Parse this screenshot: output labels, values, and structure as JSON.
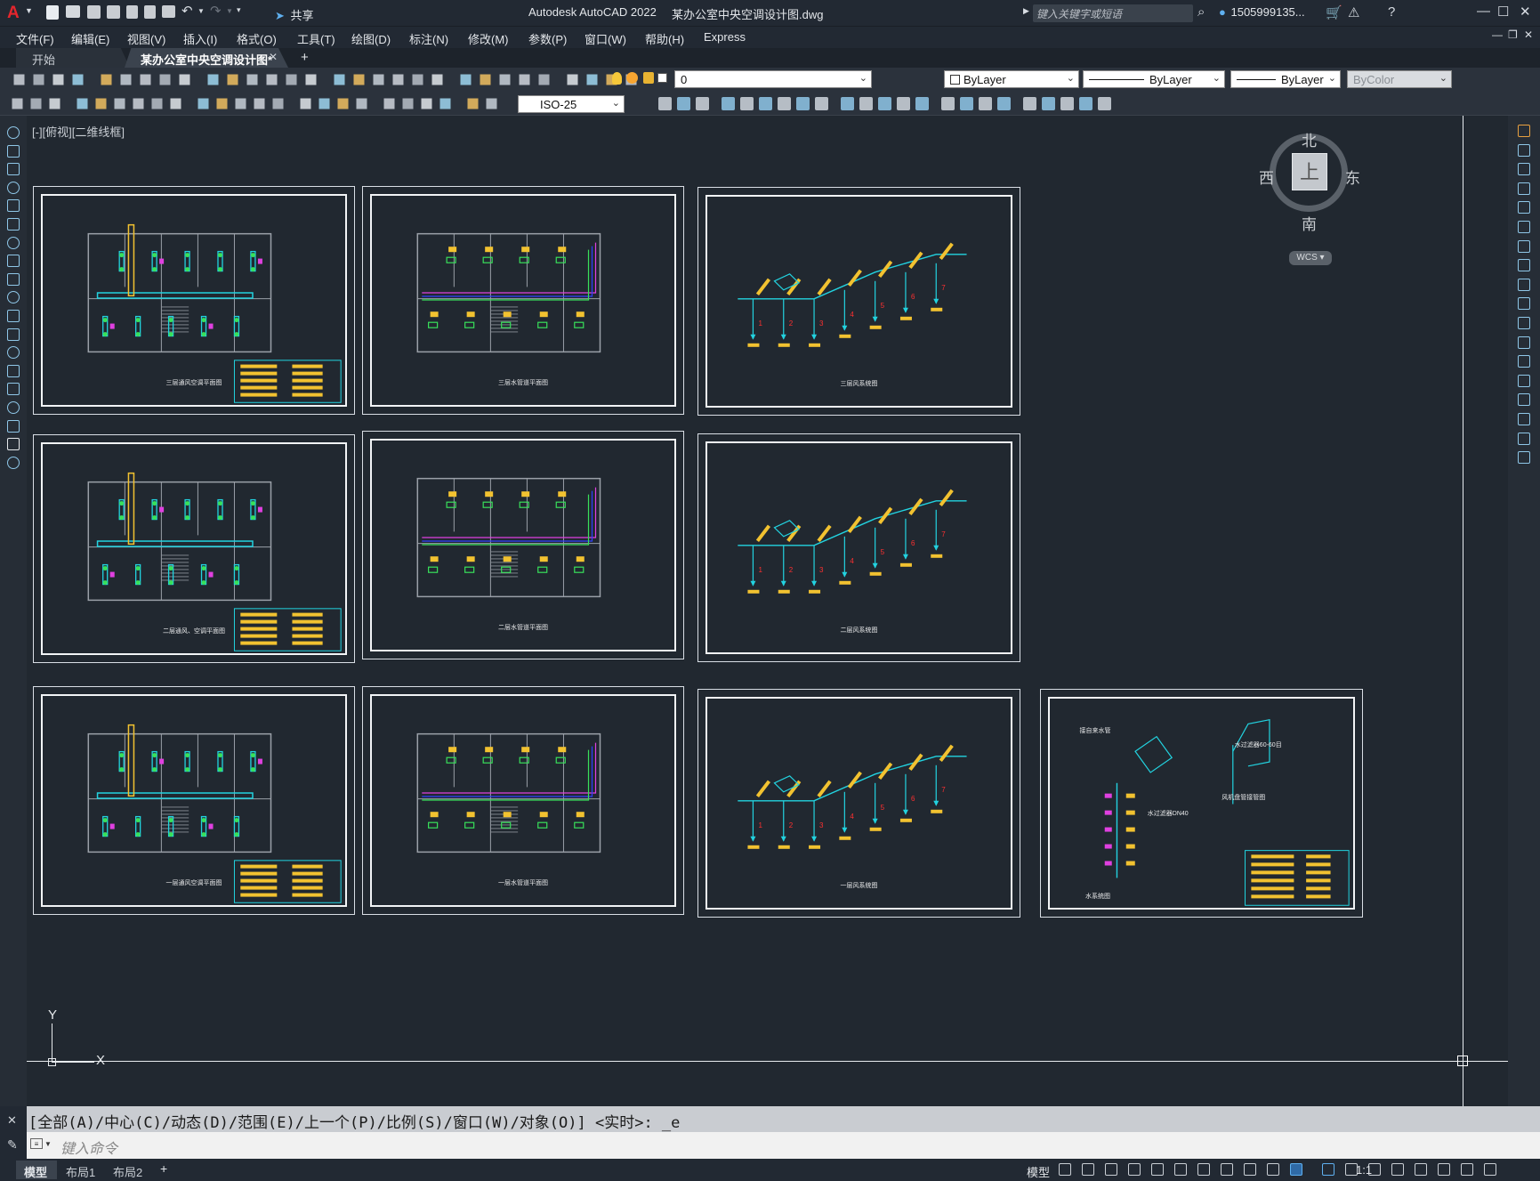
{
  "titlebar": {
    "app_title": "Autodesk AutoCAD 2022",
    "file_title": "某办公室中央空调设计图.dwg",
    "share_label": "共享",
    "search_placeholder": "键入关键字或短语",
    "user_label": "1505999135..."
  },
  "menu": [
    "文件(F)",
    "编辑(E)",
    "视图(V)",
    "插入(I)",
    "格式(O)",
    "工具(T)",
    "绘图(D)",
    "标注(N)",
    "修改(M)",
    "参数(P)",
    "窗口(W)",
    "帮助(H)",
    "Express"
  ],
  "tabs": {
    "start": "开始",
    "active": "某办公室中央空调设计图*",
    "add": "+"
  },
  "ribbon": {
    "layer_value": "0",
    "color_value": "ByLayer",
    "linetype_value": "ByLayer",
    "lineweight_value": "ByLayer",
    "plotstyle_value": "ByColor",
    "dimstyle_value": "ISO-25"
  },
  "viewport": {
    "label": "[-][俯视][二维线框]"
  },
  "viewcube": {
    "north": "北",
    "south": "南",
    "west": "西",
    "east": "东",
    "top": "上",
    "wcs": "WCS"
  },
  "ucs": {
    "y": "Y",
    "x": "X"
  },
  "sheets": [
    {
      "caption": "三层通风空调平面图"
    },
    {
      "caption": "三层水管道平面图"
    },
    {
      "caption": "三层风系统图"
    },
    {
      "caption": "二层通风、空调平面图"
    },
    {
      "caption": "二层水管道平面图"
    },
    {
      "caption": "二层风系统图"
    },
    {
      "caption": "一层通风空调平面图"
    },
    {
      "caption": "一层水管道平面图"
    },
    {
      "caption": "一层风系统图"
    },
    {
      "caption": "水系统图"
    }
  ],
  "sheet_annotations": {
    "fan_coil_label": "风机盘管接管图",
    "filter_label": "水过滤器60-60目",
    "note1": "接自来水管",
    "note2": "水过滤器DN40"
  },
  "command": {
    "history": "[全部(A)/中心(C)/动态(D)/范围(E)/上一个(P)/比例(S)/窗口(W)/对象(O)] <实时>: _e",
    "input_placeholder": "键入命令"
  },
  "statusbar": {
    "model_tab": "模型",
    "layout1": "布局1",
    "layout2": "布局2",
    "model_label": "模型",
    "scale": "1:1"
  },
  "colors": {
    "background": "#212830",
    "cyan": "#22d3e0",
    "yellow": "#f2c230",
    "green": "#38e05a",
    "magenta": "#e040e0",
    "red": "#ff3030"
  }
}
